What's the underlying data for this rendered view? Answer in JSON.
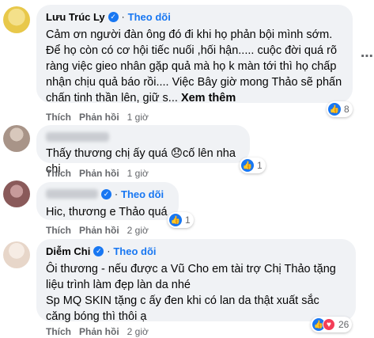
{
  "labels": {
    "like": "Thích",
    "reply": "Phản hồi",
    "follow": "Theo dõi",
    "dot": "·",
    "see_more": "Xem thêm"
  },
  "comments": [
    {
      "author": "Lưu Trúc Ly",
      "verified": true,
      "show_follow": true,
      "text": "Cảm ơn người đàn ông đó đi khi họ phản bội mình sớm. Để họ còn có cơ hội tiếc nuối ,hối hận..... cuộc đời quá rõ ràng việc gieo nhân gặp quả mà họ k màn tới thì họ chấp nhận chịu quả báo rồi.... Việc Bây giờ mong Thảo sẽ phấn chấn tinh thần lên, giữ s...",
      "time": "1 giờ",
      "reactions": {
        "types": [
          "like"
        ],
        "count": "8"
      },
      "avatar_color": "#e8c84a"
    },
    {
      "author": "",
      "verified": false,
      "show_follow": false,
      "text": "Thấy thương chị ấy quá 😞cố lên nha chị",
      "time": "1 giờ",
      "reactions": {
        "types": [
          "like"
        ],
        "count": "1"
      },
      "avatar_color": "#b9a79a"
    },
    {
      "author": "",
      "verified": true,
      "show_follow": true,
      "text": "Hic, thương e Thảo quá",
      "time": "2 giờ",
      "reactions": {
        "types": [
          "like"
        ],
        "count": "1"
      },
      "avatar_color": "#9a6a6a"
    },
    {
      "author": "Diễm Chi",
      "verified": true,
      "show_follow": true,
      "text": "Ôi thương - nếu được a Vũ Cho em tài trợ Chị Thảo tặng liệu trình làm đẹp làn da nhé\nSp MQ SKIN tặng c ấy đen khi có lan da thật xuất sắc căng bóng thì thôi ạ",
      "time": "2 giờ",
      "reactions": {
        "types": [
          "like",
          "love"
        ],
        "count": "26"
      },
      "avatar_color": "#e7d6c9"
    }
  ],
  "icons": {
    "more": "more-dots-icon",
    "like": "like-icon",
    "love": "love-icon",
    "verified": "verified-badge-icon"
  },
  "colors": {
    "accent": "#1877f2",
    "bubble": "#f0f2f5",
    "meta": "#65676b",
    "love": "#f33e58"
  }
}
